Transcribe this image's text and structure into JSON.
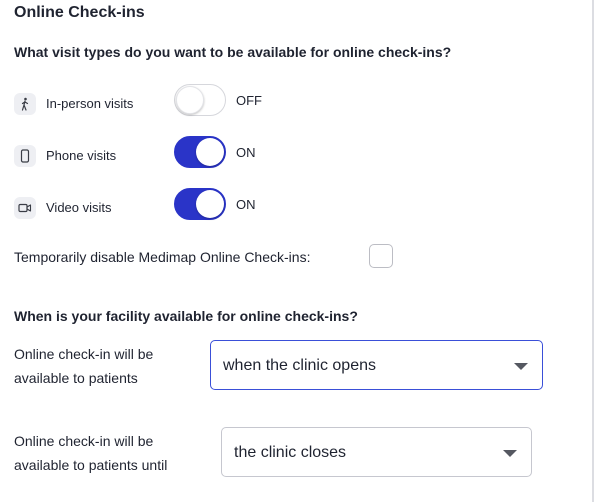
{
  "page": {
    "title": "Online Check-ins"
  },
  "visit_types": {
    "question": "What visit types do you want to be available for online check-ins?",
    "items": [
      {
        "label": "In-person visits",
        "state": "OFF",
        "icon": "walking-person-icon"
      },
      {
        "label": "Phone visits",
        "state": "ON",
        "icon": "phone-icon"
      },
      {
        "label": "Video visits",
        "state": "ON",
        "icon": "video-camera-icon"
      }
    ]
  },
  "disable": {
    "label": "Temporarily disable Medimap Online Check-ins:",
    "checked": false
  },
  "availability": {
    "question": "When is your facility available for online check-ins?",
    "start": {
      "label_line1": "Online check-in will be",
      "label_line2": "available to patients",
      "value": "when the clinic opens"
    },
    "end": {
      "label_line1": "Online check-in will be",
      "label_line2": "available to patients until",
      "value": "the clinic closes"
    }
  },
  "colors": {
    "toggle_on": "#2a34c8",
    "toggle_off": "#ffffff",
    "focus_border": "#3a4fd8"
  }
}
